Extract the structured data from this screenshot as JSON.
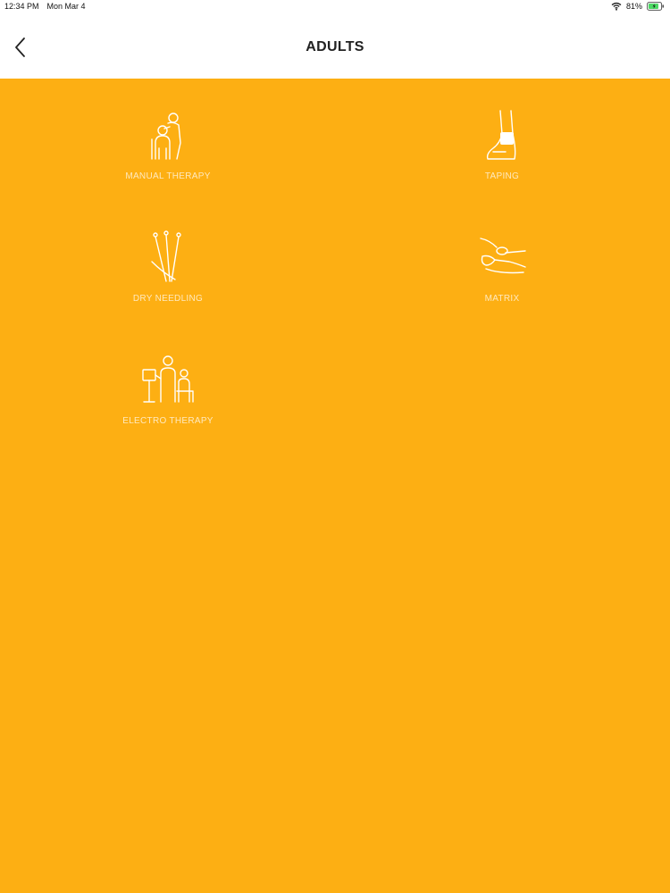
{
  "status_bar": {
    "time": "12:34 PM",
    "date": "Mon Mar 4",
    "battery_percent": "81%",
    "wifi_icon": "wifi-icon",
    "battery_icon": "battery-icon"
  },
  "nav": {
    "title": "ADULTS",
    "back_icon": "chevron-left-icon"
  },
  "colors": {
    "background": "#FDAF13",
    "nav_background": "#FFFFFF",
    "label": "#FFE9BE",
    "battery_fill": "#4CD964"
  },
  "tiles": [
    {
      "label": "MANUAL THERAPY",
      "icon": "manual-therapy-icon"
    },
    {
      "label": "TAPING",
      "icon": "taping-icon"
    },
    {
      "label": "DRY NEEDLING",
      "icon": "dry-needling-icon"
    },
    {
      "label": "MATRIX",
      "icon": "matrix-icon"
    },
    {
      "label": "ELECTRO THERAPY",
      "icon": "electro-therapy-icon"
    }
  ]
}
